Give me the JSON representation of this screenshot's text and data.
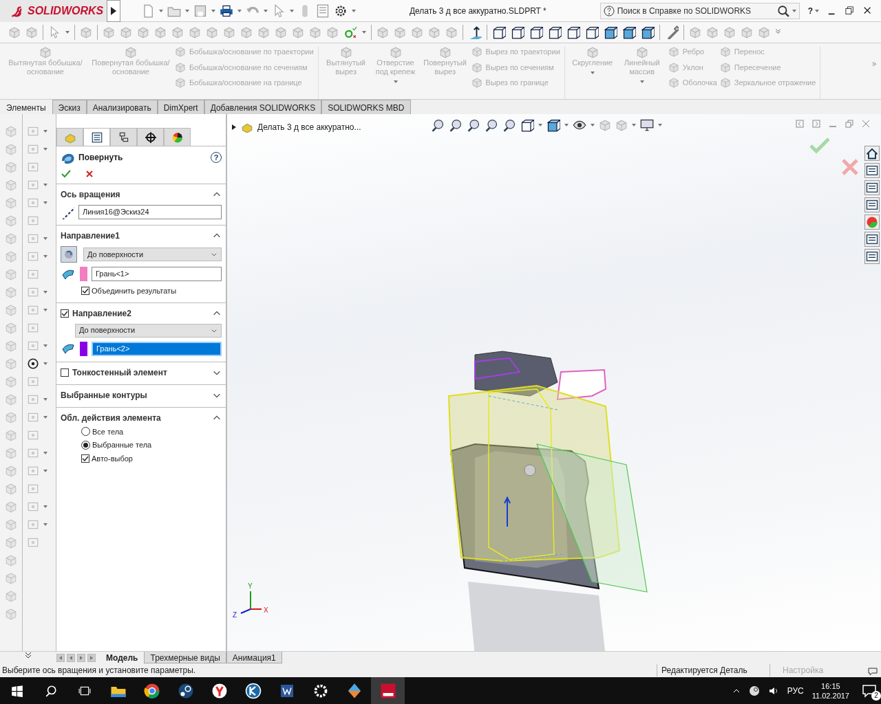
{
  "app": {
    "logo": "SOLIDWORKS",
    "title": "Делать 3 д все аккуратно.SLDPRT *",
    "help_search": {
      "placeholder": "Поиск в Справке по SOLIDWORKS"
    },
    "help": "?"
  },
  "ribbon": [
    {
      "items": [
        {
          "kind": "large",
          "label": "Вытянутая бобышка/основание",
          "disabled": true
        },
        {
          "kind": "large",
          "label": "Повернутая бобышка/основание",
          "disabled": true
        },
        {
          "kind": "stack",
          "items": [
            {
              "label": "Бобышка/основание по траектории",
              "disabled": true
            },
            {
              "label": "Бобышка/основание по сечениям",
              "disabled": true
            },
            {
              "label": "Бобышка/основание на границе",
              "disabled": true
            }
          ]
        }
      ]
    },
    {
      "items": [
        {
          "kind": "large",
          "label": "Вытянутый вырез",
          "disabled": true
        },
        {
          "kind": "large",
          "label": "Отверстие под крепеж",
          "dropdown": true,
          "disabled": true
        },
        {
          "kind": "large",
          "label": "Повернутый вырез",
          "disabled": true
        },
        {
          "kind": "stack",
          "items": [
            {
              "label": "Вырез по траектории",
              "disabled": true
            },
            {
              "label": "Вырез по сечениям",
              "disabled": true
            },
            {
              "label": "Вырез по границе",
              "disabled": true
            }
          ]
        }
      ]
    },
    {
      "items": [
        {
          "kind": "large",
          "label": "Скругление",
          "dropdown": true,
          "disabled": true
        },
        {
          "kind": "large",
          "label": "Линейный массив",
          "dropdown": true,
          "disabled": true
        },
        {
          "kind": "stack",
          "items": [
            {
              "label": "Ребро",
              "disabled": true
            },
            {
              "label": "Уклон",
              "disabled": true
            },
            {
              "label": "Оболочка",
              "disabled": true
            }
          ]
        },
        {
          "kind": "stack",
          "items": [
            {
              "label": "Перенос",
              "disabled": true
            },
            {
              "label": "Пересечение",
              "disabled": true
            },
            {
              "label": "Зеркальное отражение",
              "disabled": true
            }
          ]
        }
      ]
    }
  ],
  "tabs": [
    {
      "label": "Элементы",
      "selected": true
    },
    {
      "label": "Эскиз",
      "selected": false
    },
    {
      "label": "Анализировать",
      "selected": false
    },
    {
      "label": "DimXpert",
      "selected": false
    },
    {
      "label": "Добавления SOLIDWORKS",
      "selected": false
    },
    {
      "label": "SOLIDWORKS MBD",
      "selected": false
    }
  ],
  "feature_tree": {
    "root": "Делать 3 д все аккуратно..."
  },
  "property_manager": {
    "tabs": [
      {
        "selected": false
      },
      {
        "selected": true
      },
      {
        "selected": false
      },
      {
        "selected": false
      },
      {
        "selected": false
      }
    ],
    "title": "Повернуть",
    "help": "?",
    "sections": [
      {
        "kind": "axis",
        "title": "Ось вращения",
        "expanded": true,
        "value": "Линия16@Эскиз24"
      },
      {
        "kind": "direction",
        "title": "Направление1",
        "expanded": true,
        "end_condition": "До поверхности",
        "face": {
          "value": "Грань<1>",
          "color": "#f07ec0",
          "selected": false
        },
        "merge": {
          "label": "Объединить результаты",
          "checked": true
        }
      },
      {
        "kind": "direction",
        "title": "Направление2",
        "checked": true,
        "expanded": true,
        "end_condition": "До поверхности",
        "face": {
          "value": "Грань<2>",
          "color": "#8a00e6",
          "selected": true
        }
      },
      {
        "title": "Тонкостенный элемент",
        "checked": false,
        "expanded": false
      },
      {
        "title": "Выбранные контуры",
        "expanded": false
      },
      {
        "kind": "scope",
        "title": "Обл. действия элемента",
        "expanded": true,
        "options": [
          {
            "kind": "radio",
            "label": "Все тела",
            "checked": false
          },
          {
            "kind": "radio",
            "label": "Выбранные тела",
            "checked": true
          },
          {
            "kind": "checkbox",
            "label": "Авто-выбор",
            "checked": true
          }
        ]
      }
    ]
  },
  "triad": {
    "y": "Y",
    "z": "Z",
    "x": "X"
  },
  "bottom_tabs": [
    {
      "label": "Модель",
      "selected": true
    },
    {
      "label": "Трехмерные виды",
      "selected": false
    },
    {
      "label": "Анимация1",
      "selected": false
    }
  ],
  "status_bar": {
    "message": "Выберите ось вращения и установите параметры.",
    "mode": "Редактируется Деталь",
    "settings": "Настройка"
  },
  "taskbar": {
    "language": "РУС",
    "time": "16:15",
    "date": "11.02.2017",
    "notifications": "2"
  }
}
